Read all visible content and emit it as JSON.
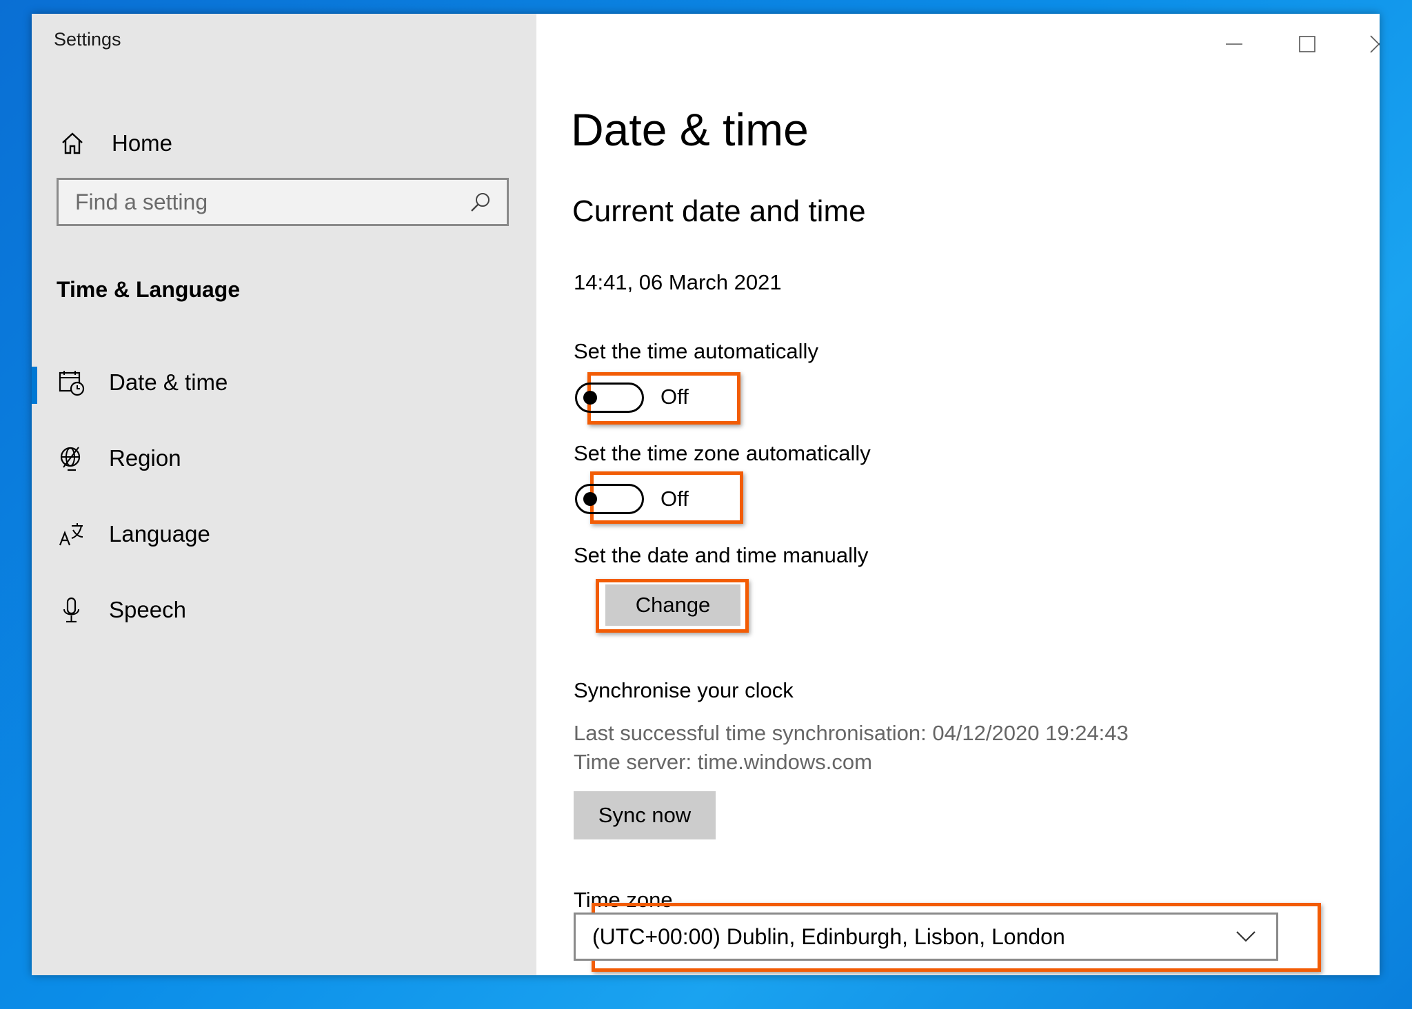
{
  "window": {
    "title": "Settings"
  },
  "sidebar": {
    "home_label": "Home",
    "search_placeholder": "Find a setting",
    "section_heading": "Time & Language",
    "items": [
      {
        "label": "Date & time",
        "icon": "calendar-clock-icon",
        "active": true
      },
      {
        "label": "Region",
        "icon": "globe-icon",
        "active": false
      },
      {
        "label": "Language",
        "icon": "language-icon",
        "active": false
      },
      {
        "label": "Speech",
        "icon": "microphone-icon",
        "active": false
      }
    ]
  },
  "main": {
    "title": "Date & time",
    "subtitle": "Current date and time",
    "current_datetime": "14:41, 06 March 2021",
    "auto_time": {
      "label": "Set the time automatically",
      "state": "Off",
      "on": false
    },
    "auto_timezone": {
      "label": "Set the time zone automatically",
      "state": "Off",
      "on": false
    },
    "manual": {
      "label": "Set the date and time manually",
      "button": "Change"
    },
    "sync": {
      "heading": "Synchronise your clock",
      "last_sync": "Last successful time synchronisation: 04/12/2020 19:24:43",
      "server": "Time server: time.windows.com",
      "button": "Sync now"
    },
    "timezone": {
      "label": "Time zone",
      "selected": "(UTC+00:00) Dublin, Edinburgh, Lisbon, London"
    }
  },
  "colors": {
    "highlight": "#f25c05",
    "accent": "#0078d4",
    "sidebar_bg": "#e6e6e6"
  }
}
